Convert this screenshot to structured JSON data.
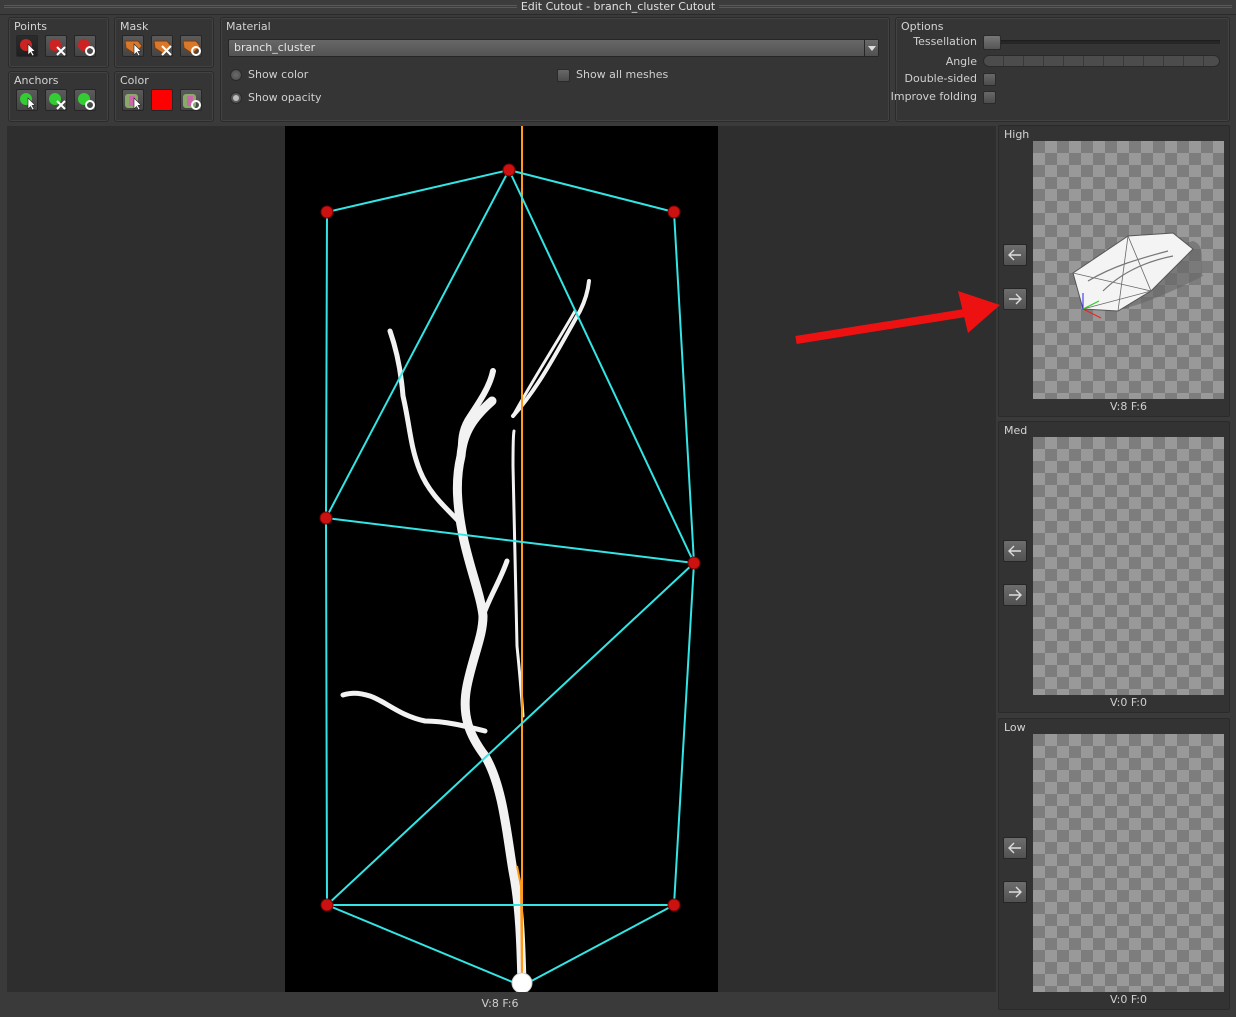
{
  "window": {
    "title": "Edit Cutout - branch_cluster Cutout"
  },
  "toolbar": {
    "points_label": "Points",
    "mask_label": "Mask",
    "anchors_label": "Anchors",
    "color_label": "Color",
    "material_label": "Material",
    "options_label": "Options"
  },
  "material": {
    "selected": "branch_cluster",
    "show_color_label": "Show color",
    "show_opacity_label": "Show opacity",
    "show_all_meshes_label": "Show all  meshes",
    "show_color_selected": false,
    "show_opacity_selected": true,
    "show_all_meshes_checked": false
  },
  "options": {
    "tessellation_label": "Tessellation",
    "angle_label": "Angle",
    "double_sided_label": "Double-sided",
    "improve_folding_label": "Improve folding",
    "tessellation_value": 0,
    "double_sided_checked": false,
    "improve_folding_checked": false
  },
  "colors": {
    "color_swatch": "#ff0000",
    "hull_line": "#33e5e5",
    "pivot_line": "#ff9a1a",
    "point_marker": "#cc1111",
    "annotation_arrow": "#ee1111"
  },
  "viewport": {
    "stats": "V:8  F:6"
  },
  "lods": [
    {
      "label": "High",
      "stats": "V:8  F:6"
    },
    {
      "label": "Med",
      "stats": "V:0  F:0"
    },
    {
      "label": "Low",
      "stats": "V:0  F:0"
    }
  ],
  "icons": {
    "points": [
      "add-point-icon",
      "delete-point-icon",
      "reset-point-icon"
    ],
    "mask": [
      "paint-mask-icon",
      "erase-mask-icon",
      "reset-mask-icon"
    ],
    "anchors": [
      "add-anchor-icon",
      "delete-anchor-icon",
      "reset-anchor-icon"
    ],
    "color": [
      "color-picker-icon",
      "color-swatch",
      "reset-color-icon"
    ],
    "nav": [
      "arrow-left-icon",
      "arrow-right-icon"
    ]
  }
}
